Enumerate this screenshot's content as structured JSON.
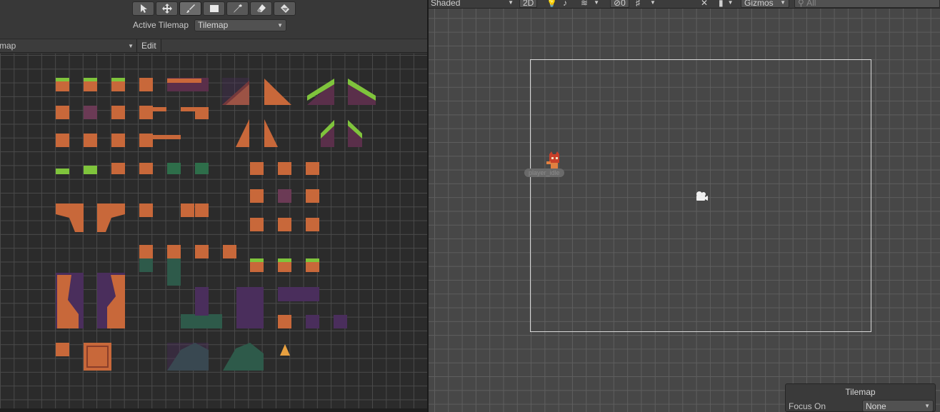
{
  "tile_palette": {
    "tools": [
      {
        "name": "select-tool",
        "icon": "cursor-icon"
      },
      {
        "name": "move-tool",
        "icon": "move-arrows-icon"
      },
      {
        "name": "paint-brush-tool",
        "icon": "brush-icon"
      },
      {
        "name": "box-fill-tool",
        "icon": "rect-icon"
      },
      {
        "name": "picker-tool",
        "icon": "eyedropper-icon"
      },
      {
        "name": "erase-tool",
        "icon": "eraser-icon"
      },
      {
        "name": "fill-tool",
        "icon": "bucket-icon"
      }
    ],
    "active_tilemap_label": "Active Tilemap",
    "active_tilemap_value": "Tilemap",
    "palette_name": "map",
    "edit_label": "Edit"
  },
  "scene": {
    "shading_mode": "Shaded",
    "mode_2d": "2D",
    "hidden_count": "0",
    "gizmos_label": "Gizmos",
    "search_placeholder": "All",
    "player_label": "player_idle"
  },
  "overlay": {
    "title": "Tilemap",
    "focus_label": "Focus On",
    "focus_value": "None"
  },
  "colors": {
    "grass": "#7fc43c",
    "dirt": "#c8683a",
    "dirt_dark": "#8a3e2a",
    "purple": "#4a2e5c",
    "moss": "#2e6e4a"
  }
}
